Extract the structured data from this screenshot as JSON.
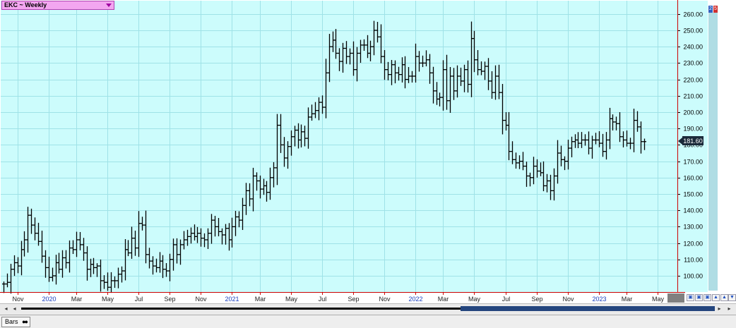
{
  "symbol": {
    "label": "EKC ~ Weekly",
    "dropdown_icon": "triangle-down-icon"
  },
  "last_price_label": "181.60",
  "status": {
    "tab_label": "Bars",
    "tab_icon": "two-dots-icon"
  },
  "scroll_buttons": {
    "left": "◂",
    "right": "▸",
    "end_left": "◂",
    "end_right": "▸"
  },
  "top_buttons": [
    "2",
    "5"
  ],
  "colors": {
    "plot_bg": "#ccfcfc",
    "grid": "#9fe2e7",
    "bars": "#000000",
    "axis_line": "#cc0000",
    "year_text": "#1a40c0",
    "price_marker_bg": "#1a2a3a"
  },
  "chart_data": {
    "type": "ohlc",
    "title": "EKC ~ Weekly",
    "ylim": [
      90,
      265
    ],
    "yticks": [
      100,
      110,
      120,
      130,
      140,
      150,
      160,
      170,
      180,
      190,
      200,
      210,
      220,
      230,
      240,
      250,
      260
    ],
    "ytick_labels": [
      "100.00",
      "110.00",
      "120.00",
      "130.00",
      "140.00",
      "150.00",
      "160.00",
      "170.00",
      "180.00",
      "190.00",
      "200.00",
      "210.00",
      "220.00",
      "230.00",
      "240.00",
      "250.00",
      "260.00"
    ],
    "last_value": 181.6,
    "grid": true,
    "bar_spacing_weeks": 1,
    "x_labels": [
      {
        "label": "Nov",
        "week": 4,
        "year": false
      },
      {
        "label": "2020",
        "week": 13,
        "year": true
      },
      {
        "label": "Mar",
        "week": 21,
        "year": false
      },
      {
        "label": "May",
        "week": 30,
        "year": false
      },
      {
        "label": "Jul",
        "week": 39,
        "year": false
      },
      {
        "label": "Sep",
        "week": 48,
        "year": false
      },
      {
        "label": "Nov",
        "week": 57,
        "year": false
      },
      {
        "label": "2021",
        "week": 66,
        "year": true
      },
      {
        "label": "Mar",
        "week": 74,
        "year": false
      },
      {
        "label": "May",
        "week": 83,
        "year": false
      },
      {
        "label": "Jul",
        "week": 92,
        "year": false
      },
      {
        "label": "Sep",
        "week": 101,
        "year": false
      },
      {
        "label": "Nov",
        "week": 110,
        "year": false
      },
      {
        "label": "2022",
        "week": 119,
        "year": true
      },
      {
        "label": "Mar",
        "week": 127,
        "year": false
      },
      {
        "label": "May",
        "week": 136,
        "year": false
      },
      {
        "label": "Jul",
        "week": 145,
        "year": false
      },
      {
        "label": "Sep",
        "week": 154,
        "year": false
      },
      {
        "label": "Nov",
        "week": 163,
        "year": false
      },
      {
        "label": "2023",
        "week": 172,
        "year": true
      },
      {
        "label": "Mar",
        "week": 180,
        "year": false
      },
      {
        "label": "May",
        "week": 189,
        "year": false
      }
    ],
    "closes": [
      95,
      96,
      104,
      108,
      106,
      116,
      122,
      137,
      131,
      126,
      121,
      112,
      105,
      99,
      100,
      108,
      104,
      111,
      108,
      117,
      116,
      122,
      119,
      114,
      104,
      107,
      105,
      106,
      97,
      96,
      93,
      97,
      97,
      101,
      103,
      116,
      114,
      123,
      117,
      132,
      131,
      113,
      109,
      106,
      105,
      109,
      104,
      103,
      110,
      119,
      113,
      119,
      122,
      124,
      126,
      124,
      126,
      123,
      122,
      126,
      134,
      130,
      127,
      125,
      129,
      122,
      130,
      136,
      134,
      143,
      152,
      147,
      161,
      158,
      153,
      155,
      151,
      160,
      166,
      192,
      180,
      172,
      179,
      185,
      189,
      183,
      188,
      184,
      197,
      199,
      201,
      206,
      203,
      224,
      240,
      244,
      236,
      231,
      239,
      234,
      236,
      226,
      236,
      241,
      241,
      236,
      240,
      250,
      246,
      234,
      226,
      223,
      229,
      224,
      223,
      229,
      220,
      222,
      222,
      234,
      230,
      230,
      232,
      224,
      213,
      208,
      209,
      226,
      207,
      222,
      213,
      222,
      219,
      226,
      217,
      245,
      232,
      226,
      225,
      228,
      219,
      212,
      222,
      212,
      195,
      192,
      176,
      171,
      169,
      170,
      167,
      161,
      160,
      167,
      164,
      163,
      155,
      158,
      152,
      161,
      175,
      171,
      170,
      178,
      182,
      183,
      181,
      183,
      183,
      178,
      183,
      183,
      181,
      176,
      183,
      196,
      194,
      193,
      185,
      183,
      181,
      181,
      195,
      191,
      182,
      182
    ]
  }
}
